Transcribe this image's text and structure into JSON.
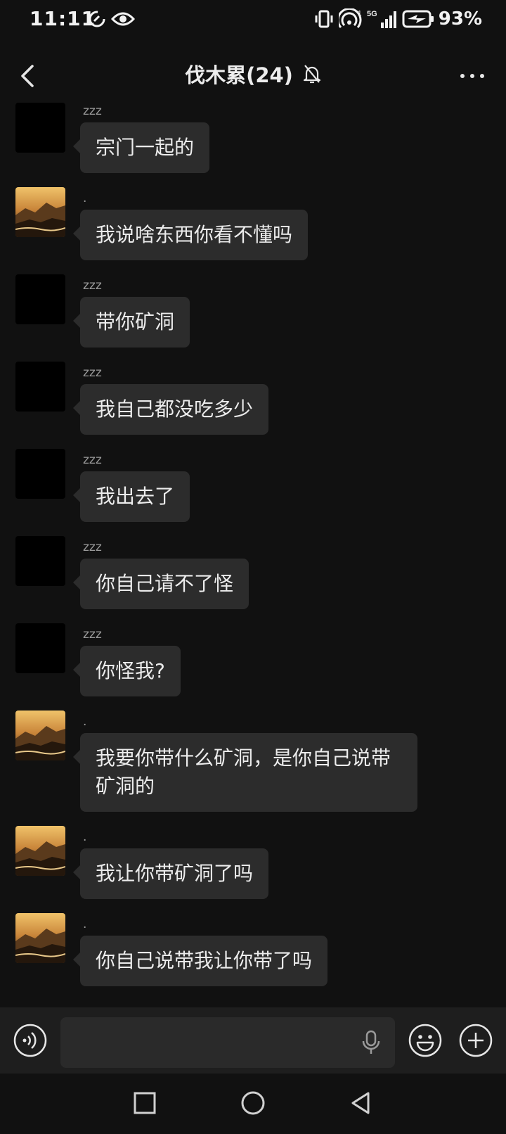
{
  "status_bar": {
    "time": "11:11",
    "network": "5G",
    "sim_slot": "1",
    "battery": "93%"
  },
  "header": {
    "title": "伐木累(24)",
    "icons": {
      "back": "back-arrow-icon",
      "mute": "bell-off-icon",
      "more": "more-dots-icon"
    }
  },
  "messages": [
    {
      "sender": "zzz",
      "avatar": "black",
      "text": "宗门一起的"
    },
    {
      "sender": ".",
      "avatar": "landscape",
      "text": "我说啥东西你看不懂吗"
    },
    {
      "sender": "zzz",
      "avatar": "black",
      "text": "带你矿洞"
    },
    {
      "sender": "zzz",
      "avatar": "black",
      "text": "我自己都没吃多少"
    },
    {
      "sender": "zzz",
      "avatar": "black",
      "text": "我出去了"
    },
    {
      "sender": "zzz",
      "avatar": "black",
      "text": "你自己请不了怪"
    },
    {
      "sender": "zzz",
      "avatar": "black",
      "text": "你怪我?"
    },
    {
      "sender": ".",
      "avatar": "landscape",
      "text": "我要你带什么矿洞，是你自己说带矿洞的"
    },
    {
      "sender": ".",
      "avatar": "landscape",
      "text": "我让你带矿洞了吗"
    },
    {
      "sender": ".",
      "avatar": "landscape",
      "text": "你自己说带我让你带了吗"
    }
  ],
  "input_bar": {
    "icons": {
      "voice": "voice-toggle-icon",
      "mic": "microphone-icon",
      "emoji": "emoji-icon",
      "plus": "plus-icon"
    }
  },
  "nav_bar": {
    "icons": {
      "recents": "square-recents-icon",
      "home": "circle-home-icon",
      "back": "triangle-back-icon"
    }
  },
  "colors": {
    "background": "#111111",
    "bubble": "#2c2c2c",
    "text": "#ececec",
    "sender": "#9a9a9a",
    "input_bar": "#1e1e1e"
  }
}
